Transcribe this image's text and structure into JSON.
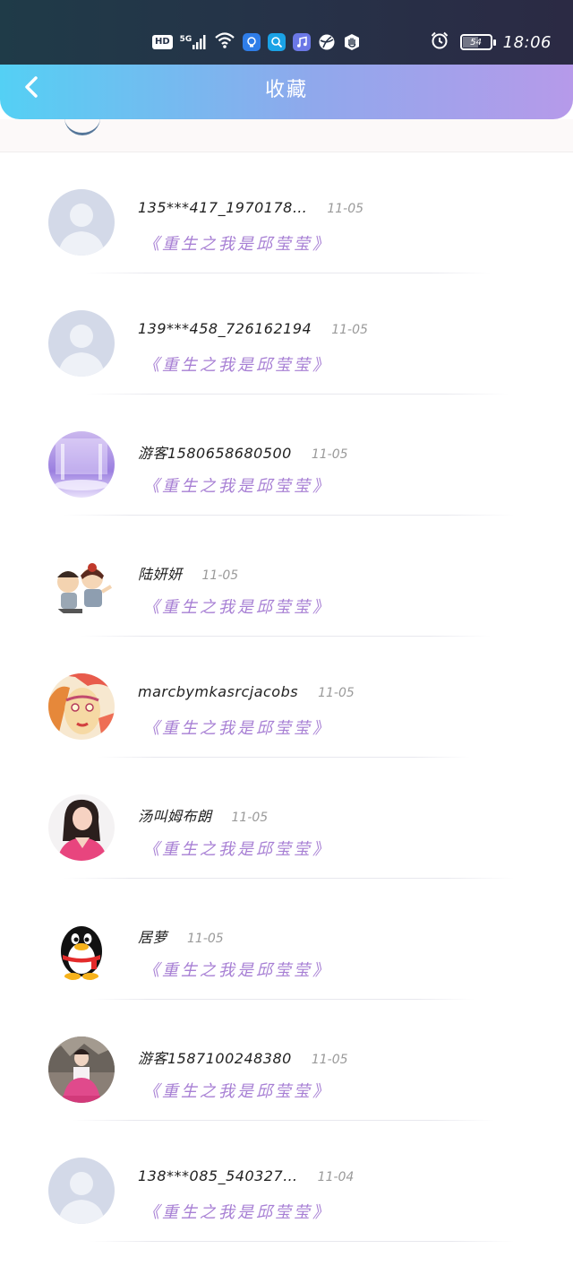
{
  "status_bar": {
    "network_labels": [
      "HD",
      "5G"
    ],
    "battery": "54",
    "time": "18:06",
    "icons": [
      "hd-badge-icon",
      "signal-icon",
      "wifi-icon",
      "app-bulb-icon",
      "app-search-icon",
      "app-music-icon",
      "app-globe-icon",
      "app-hand-icon",
      "alarm-icon",
      "battery-icon"
    ]
  },
  "navbar": {
    "title": "收藏",
    "back_icon": "chevron-left-icon"
  },
  "colors": {
    "nav_gradient_start": "#54d0f4",
    "nav_gradient_end": "#b69aea",
    "book_title": "#a77fd4",
    "date": "#9a9a9a"
  },
  "favorites": [
    {
      "user": "135***417_1970178…",
      "date": "11-05",
      "book": "《重生之我是邱莹莹》",
      "avatar": "default-avatar"
    },
    {
      "user": "139***458_726162194",
      "date": "11-05",
      "book": "《重生之我是邱莹莹》",
      "avatar": "default-avatar"
    },
    {
      "user": "游客1580658680500",
      "date": "11-05",
      "book": "《重生之我是邱莹莹》",
      "avatar": "purple-light-avatar"
    },
    {
      "user": "陆妍妍",
      "date": "11-05",
      "book": "《重生之我是邱莹莹》",
      "avatar": "cartoon-couple-avatar"
    },
    {
      "user": "marcbymkasrcjacobs",
      "date": "11-05",
      "book": "《重生之我是邱莹莹》",
      "avatar": "painted-face-avatar"
    },
    {
      "user": "汤叫姆布朗",
      "date": "11-05",
      "book": "《重生之我是邱莹莹》",
      "avatar": "woman-photo-avatar"
    },
    {
      "user": "居萝",
      "date": "11-05",
      "book": "《重生之我是邱莹莹》",
      "avatar": "qq-penguin-avatar"
    },
    {
      "user": "游客1587100248380",
      "date": "11-05",
      "book": "《重生之我是邱莹莹》",
      "avatar": "girl-photo-avatar"
    },
    {
      "user": "138***085_540327…",
      "date": "11-04",
      "book": "《重生之我是邱莹莹》",
      "avatar": "default-avatar"
    }
  ]
}
